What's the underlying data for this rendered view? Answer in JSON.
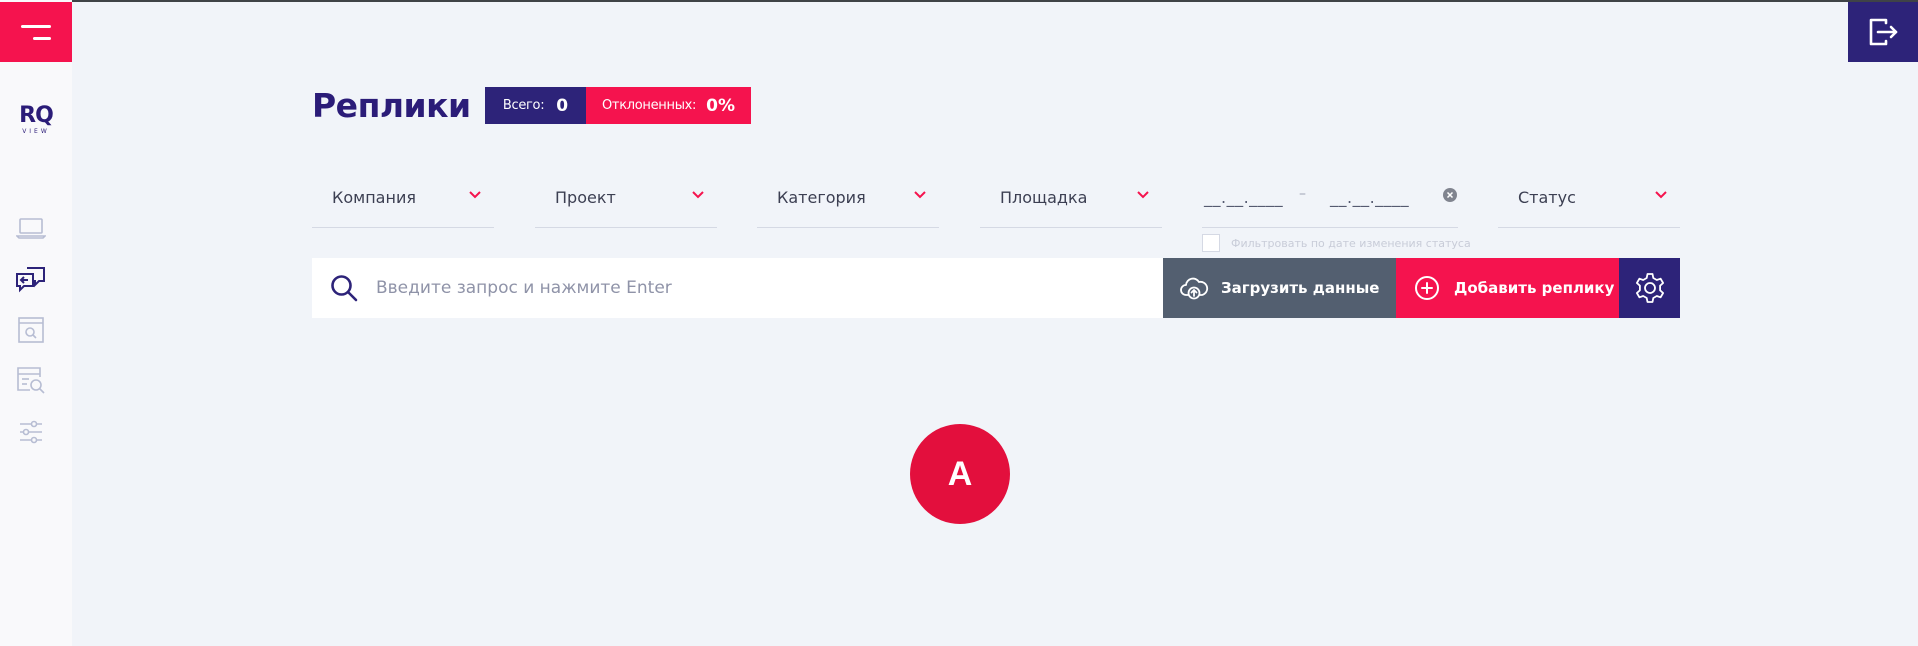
{
  "app": {
    "logo_text": "RQ",
    "logo_sub": "VIEW"
  },
  "header": {
    "title": "Реплики",
    "stats": {
      "total_label": "Всего:",
      "total_value": "0",
      "rejected_label": "Отклоненных:",
      "rejected_value": "0%"
    }
  },
  "filters": {
    "company": "Компания",
    "project": "Проект",
    "category": "Категория",
    "platform": "Площадка",
    "date_from": "__.__.____",
    "date_to": "__.__.____",
    "date_separator": "–",
    "status": "Статус",
    "status_date_checkbox_label": "Фильтровать по дате изменения статуса"
  },
  "search": {
    "placeholder": "Введите запрос и нажмите Enter",
    "value": ""
  },
  "actions": {
    "upload_label": "Загрузить данные",
    "add_label": "Добавить реплику"
  },
  "user": {
    "avatar_letter": "A"
  },
  "icons": {
    "menu": "menu-icon",
    "logout": "logout-icon",
    "nav": [
      "laptop-icon",
      "chat-reply-icon",
      "browser-search-icon",
      "list-search-icon",
      "sliders-icon"
    ],
    "search": "search-icon",
    "upload": "cloud-upload-icon",
    "add": "plus-circle-icon",
    "settings": "gear-icon"
  },
  "colors": {
    "primary": "#2d2379",
    "accent": "#f5134e",
    "upload_button": "#535f70",
    "background": "#f1f4f9",
    "avatar": "#e30f3d"
  }
}
